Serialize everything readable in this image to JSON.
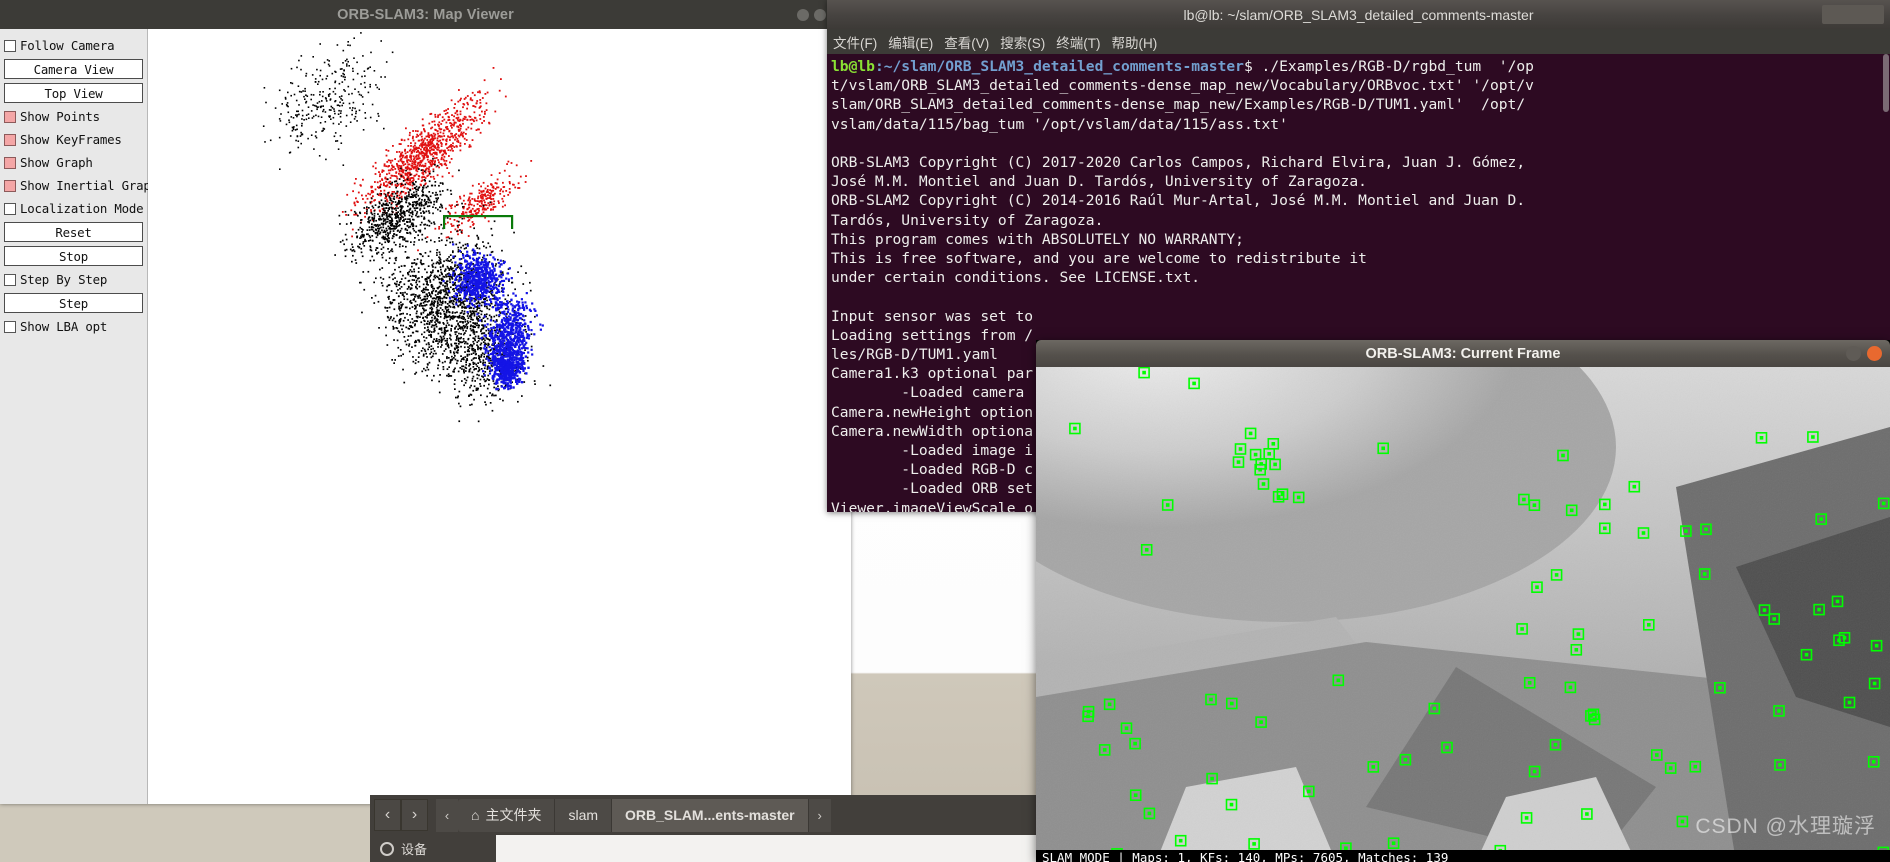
{
  "desktop": {
    "background_color": "#c3bcae"
  },
  "map_viewer": {
    "title": "ORB-SLAM3: Map Viewer",
    "window_buttons": [
      "minimize",
      "maximize",
      "close"
    ],
    "panel": {
      "items": [
        {
          "type": "checkbox",
          "label": "Follow Camera",
          "checked": false
        },
        {
          "type": "button",
          "label": "Camera View"
        },
        {
          "type": "button",
          "label": "Top View"
        },
        {
          "type": "checkbox",
          "label": "Show Points",
          "checked": true
        },
        {
          "type": "checkbox",
          "label": "Show KeyFrames",
          "checked": true
        },
        {
          "type": "checkbox",
          "label": "Show Graph",
          "checked": true
        },
        {
          "type": "checkbox",
          "label": "Show Inertial Graph",
          "checked": true
        },
        {
          "type": "checkbox",
          "label": "Localization Mode",
          "checked": false
        },
        {
          "type": "button",
          "label": "Reset"
        },
        {
          "type": "button",
          "label": "Stop"
        },
        {
          "type": "checkbox",
          "label": "Step By Step",
          "checked": false
        },
        {
          "type": "button",
          "label": "Step"
        },
        {
          "type": "checkbox",
          "label": "Show LBA opt",
          "checked": false
        }
      ]
    },
    "map": {
      "point_colors": {
        "map_points": "#000000",
        "keyframes": "#1414e6",
        "graph": "#e01010"
      },
      "background": "#ffffff"
    }
  },
  "terminal": {
    "title": "lb@lb: ~/slam/ORB_SLAM3_detailed_comments-master",
    "menu": [
      "文件(F)",
      "编辑(E)",
      "查看(V)",
      "搜索(S)",
      "终端(T)",
      "帮助(H)"
    ],
    "prompt_user": "lb@lb",
    "prompt_path": ":~/slam/ORB_SLAM3_detailed_comments-master",
    "prompt_symbol": "$",
    "command": " ./Examples/RGB-D/rgbd_tum  '/op",
    "lines": [
      "t/vslam/ORB_SLAM3_detailed_comments-dense_map_new/Vocabulary/ORBvoc.txt' '/opt/v",
      "slam/ORB_SLAM3_detailed_comments-dense_map_new/Examples/RGB-D/TUM1.yaml'  /opt/",
      "vslam/data/115/bag_tum '/opt/vslam/data/115/ass.txt'",
      "",
      "ORB-SLAM3 Copyright (C) 2017-2020 Carlos Campos, Richard Elvira, Juan J. Gómez,",
      "José M.M. Montiel and Juan D. Tardós, University of Zaragoza.",
      "ORB-SLAM2 Copyright (C) 2014-2016 Raúl Mur-Artal, José M.M. Montiel and Juan D.",
      "Tardós, University of Zaragoza.",
      "This program comes with ABSOLUTELY NO WARRANTY;",
      "This is free software, and you are welcome to redistribute it",
      "under certain conditions. See LICENSE.txt.",
      "",
      "Input sensor was set to",
      "Loading settings from /",
      "les/RGB-D/TUM1.yaml",
      "Camera1.k3 optional par",
      "        -Loaded camera",
      "Camera.newHeight option",
      "Camera.newWidth optiona",
      "        -Loaded image i",
      "        -Loaded RGB-D c",
      "        -Loaded ORB set",
      "Viewer.imageViewScale o"
    ],
    "colors": {
      "background": "#2d0a22",
      "text": "#eeeeec",
      "user": "#8ae234",
      "path": "#729fcf"
    }
  },
  "current_frame": {
    "title": "ORB-SLAM3: Current Frame",
    "window_buttons": [
      "minimize",
      "close"
    ],
    "status_text": "SLAM MODE |  Maps: 1, KFs: 140, MPs: 7605, Matches: 139",
    "watermark": "CSDN @水理璇浮",
    "keypoint_color": "#00ff00"
  },
  "file_manager": {
    "nav": {
      "back": "‹",
      "forward": "›",
      "overflow": "‹"
    },
    "breadcrumbs": [
      {
        "label": "主文件夹",
        "icon": "home-icon",
        "active": false
      },
      {
        "label": "slam",
        "active": false
      },
      {
        "label": "ORB_SLAM...ents-master",
        "active": true
      }
    ],
    "next_arrow": "›",
    "sidebar_item": "设备"
  }
}
